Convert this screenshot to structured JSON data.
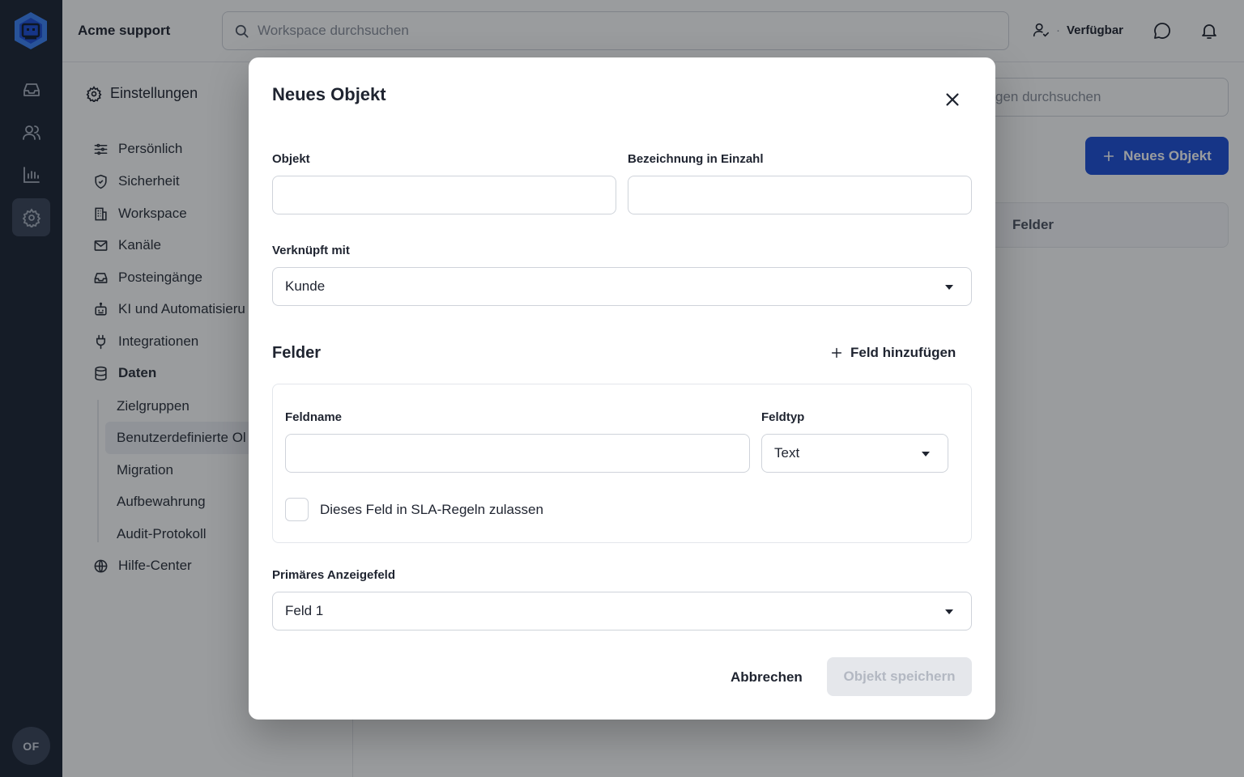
{
  "app": {
    "workspace_name": "Acme support",
    "search_placeholder": "Workspace durchsuchen",
    "status_label": "Verfügbar",
    "status_separator": "·",
    "avatar_initials": "OF",
    "accent_color": "#1d4ed8"
  },
  "rail": {
    "icons": [
      "logo-icon",
      "inbox-icon",
      "users-icon",
      "chart-icon",
      "settings-icon"
    ],
    "active": "settings-icon"
  },
  "settings": {
    "title": "Einstellungen",
    "items": [
      {
        "label": "Persönlich",
        "icon": "sliders-icon"
      },
      {
        "label": "Sicherheit",
        "icon": "shield-icon"
      },
      {
        "label": "Workspace",
        "icon": "building-icon"
      },
      {
        "label": "Kanäle",
        "icon": "mail-icon"
      },
      {
        "label": "Posteingänge",
        "icon": "inbox-icon"
      },
      {
        "label": "KI und Automatisieru",
        "icon": "robot-icon"
      },
      {
        "label": "Integrationen",
        "icon": "plug-icon"
      },
      {
        "label": "Daten",
        "icon": "database-icon"
      }
    ],
    "subitems": [
      "Zielgruppen",
      "Benutzerdefinierte Ol",
      "Migration",
      "Aufbewahrung",
      "Audit-Protokoll"
    ],
    "active_subitem": "Benutzerdefinierte Ol",
    "help": {
      "label": "Hilfe-Center",
      "icon": "globe-icon"
    }
  },
  "main": {
    "search_partial": "gen durchsuchen",
    "new_button": "Neues Objekt",
    "table_header_partial": "Felder"
  },
  "modal": {
    "title": "Neues Objekt",
    "object_label": "Objekt",
    "object_value": "",
    "singular_label": "Bezeichnung in Einzahl",
    "singular_value": "",
    "linked_label": "Verknüpft mit",
    "linked_value": "Kunde",
    "fields_title": "Felder",
    "add_field": "Feld hinzufügen",
    "field": {
      "name_label": "Feldname",
      "name_value": "",
      "type_label": "Feldtyp",
      "type_value": "Text",
      "sla_label": "Dieses Feld in SLA-Regeln zulassen",
      "sla_checked": false
    },
    "primary_label": "Primäres Anzeigefeld",
    "primary_value": "Feld 1",
    "cancel": "Abbrechen",
    "save": "Objekt speichern"
  }
}
